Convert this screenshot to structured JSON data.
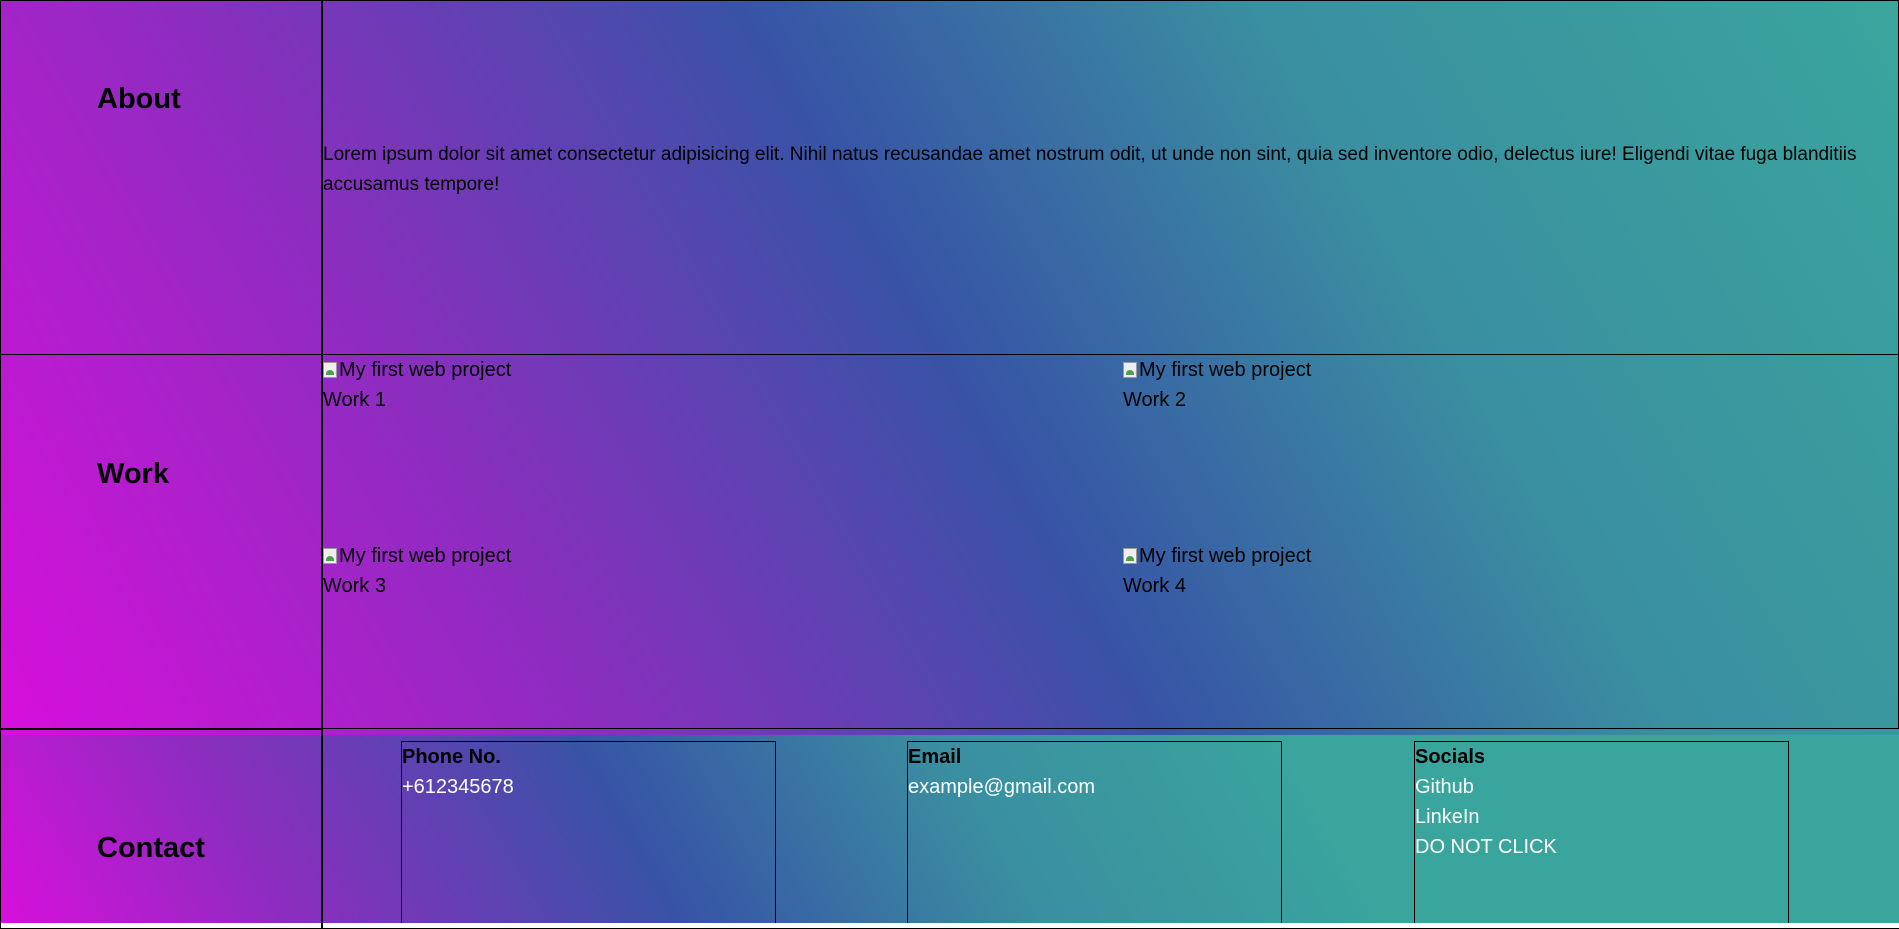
{
  "about": {
    "heading": "About",
    "text": "Lorem ipsum dolor sit amet consectetur adipisicing elit. Nihil natus recusandae amet nostrum odit, ut unde non sint, quia sed inventore odio, delectus iure! Eligendi vitae fuga blanditiis accusamus tempore!"
  },
  "work": {
    "heading": "Work",
    "items": [
      {
        "alt": "My first web project",
        "label": "Work 1"
      },
      {
        "alt": "My first web project",
        "label": "Work 2"
      },
      {
        "alt": "My first web project",
        "label": "Work 3"
      },
      {
        "alt": "My first web project",
        "label": "Work 4"
      }
    ]
  },
  "contact": {
    "heading": "Contact",
    "phone": {
      "title": "Phone No.",
      "value": "+612345678"
    },
    "email": {
      "title": "Email",
      "value": "example@gmail.com"
    },
    "socials": {
      "title": "Socials",
      "links": [
        "Github",
        "LinkeIn",
        "DO NOT CLICK"
      ]
    }
  },
  "colors": {
    "gradient_start": "#d80fdc",
    "gradient_mid": "#3853a6",
    "gradient_end": "#3aa59d"
  }
}
